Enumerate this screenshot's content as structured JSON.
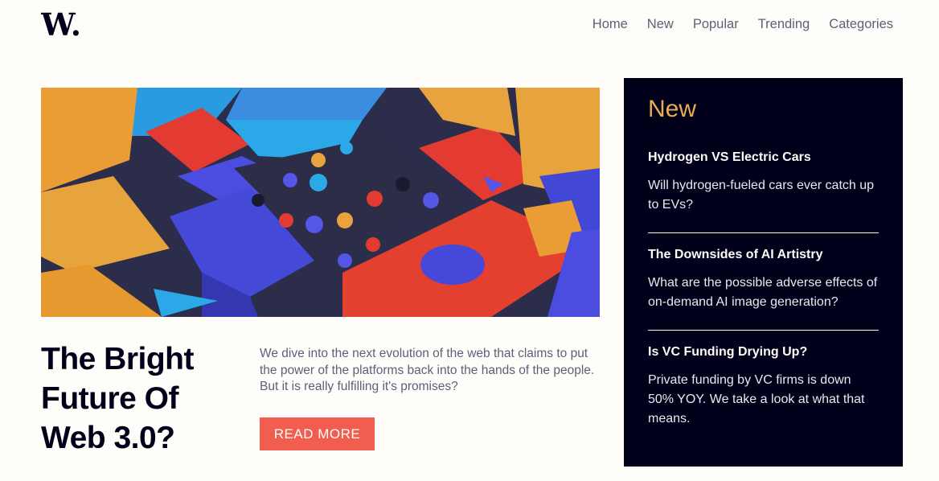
{
  "brand": {
    "logo_text": "W."
  },
  "nav": {
    "items": [
      "Home",
      "New",
      "Popular",
      "Trending",
      "Categories"
    ]
  },
  "hero": {
    "headline": "The Bright Future Of Web 3.0?",
    "description": "We dive into the next evolution of the web that claims to put the power of the platforms back into the hands of the people. But it is really fulfilling it's promises?",
    "cta_label": "READ MORE"
  },
  "sidebar": {
    "title": "New",
    "items": [
      {
        "title": "Hydrogen VS Electric Cars",
        "description": "Will hydrogen-fueled cars ever catch up to EVs?"
      },
      {
        "title": "The Downsides of AI Artistry",
        "description": "What are the possible adverse effects of on-demand AI image generation?"
      },
      {
        "title": "Is VC Funding Drying Up?",
        "description": "Private funding by VC firms is down 50% YOY. We take a look at what that means."
      }
    ]
  },
  "colors": {
    "dark": "#00001a",
    "accent_red": "#f15e50",
    "accent_orange": "#e9ab53",
    "grey": "#5d5f79",
    "off_white": "#fffdfa"
  }
}
